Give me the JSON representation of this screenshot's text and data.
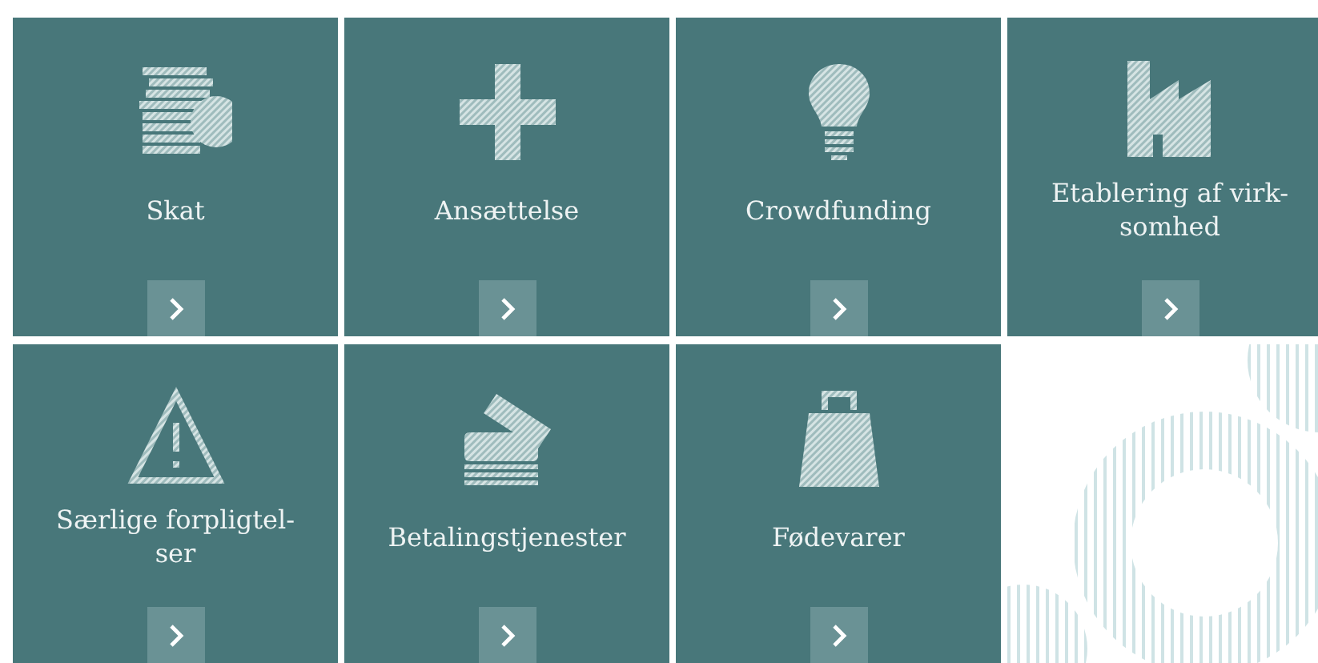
{
  "tiles": [
    {
      "title_lines": [
        "Skat"
      ]
    },
    {
      "title_lines": [
        "Ansættelse"
      ]
    },
    {
      "title_lines": [
        "Crowdfunding"
      ]
    },
    {
      "title_lines": [
        "Etablering af virk-",
        "somhed"
      ]
    },
    {
      "title_lines": [
        "Særlige forpligtel-",
        "ser"
      ]
    },
    {
      "title_lines": [
        "Betalingstjenester"
      ]
    },
    {
      "title_lines": [
        "Fødevarer"
      ]
    }
  ]
}
